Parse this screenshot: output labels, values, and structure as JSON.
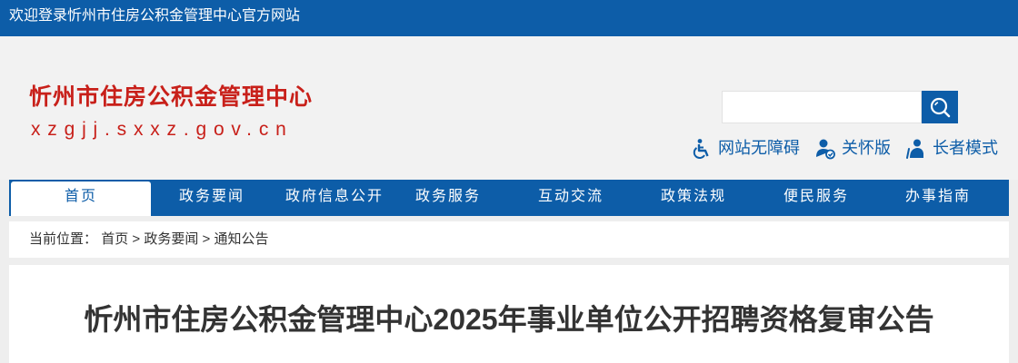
{
  "topbar": {
    "welcome": "欢迎登录忻州市住房公积金管理中心官方网站"
  },
  "header": {
    "site_title": "忻州市住房公积金管理中心",
    "site_domain": "xzgjj.sxxz.gov.cn",
    "search": {
      "placeholder": "",
      "value": ""
    },
    "tools": [
      {
        "label": "网站无障碍",
        "icon": "wheelchair-icon"
      },
      {
        "label": "关怀版",
        "icon": "care-icon"
      },
      {
        "label": "长者模式",
        "icon": "elder-icon"
      }
    ]
  },
  "nav": {
    "items": [
      {
        "label": "首页"
      },
      {
        "label": "政务要闻"
      },
      {
        "label": "政府信息公开"
      },
      {
        "label": "政务服务"
      },
      {
        "label": "互动交流"
      },
      {
        "label": "政策法规"
      },
      {
        "label": "便民服务"
      },
      {
        "label": "办事指南"
      }
    ]
  },
  "breadcrumb": {
    "prefix": "当前位置：",
    "items": [
      "首页",
      "政务要闻",
      "通知公告"
    ],
    "separator": ">"
  },
  "article": {
    "title": "忻州市住房公积金管理中心2025年事业单位公开招聘资格复审公告"
  },
  "colors": {
    "brand_blue": "#0d5da8",
    "brand_red": "#c8201a"
  }
}
